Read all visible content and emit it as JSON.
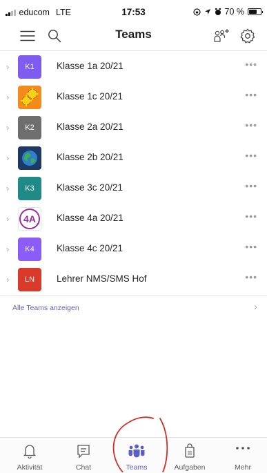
{
  "status_bar": {
    "carrier": "educom",
    "network": "LTE",
    "time": "17:53",
    "battery": "70 %",
    "battery_level": 0.7
  },
  "header": {
    "title": "Teams",
    "icons": [
      "hamburger-menu-icon",
      "search-icon",
      "add-team-icon",
      "gear-icon"
    ]
  },
  "teams": [
    {
      "name": "Klasse 1a 20/21",
      "avatar_text": "K1",
      "avatar_color": "#7e5cf0",
      "avatar_icon": ""
    },
    {
      "name": "Klasse 1c 20/21",
      "avatar_text": "",
      "avatar_color": "#f28a1c",
      "avatar_icon": "gears-icon"
    },
    {
      "name": "Klasse 2a 20/21",
      "avatar_text": "K2",
      "avatar_color": "#6e6e6e",
      "avatar_icon": ""
    },
    {
      "name": "Klasse 2b 20/21",
      "avatar_text": "",
      "avatar_color": "#1c3a63",
      "avatar_icon": "globe-icon"
    },
    {
      "name": "Klasse 3c 20/21",
      "avatar_text": "K3",
      "avatar_color": "#1f8a86",
      "avatar_icon": ""
    },
    {
      "name": "Klasse 4a 20/21",
      "avatar_text": "4A",
      "avatar_color": "#ffffff",
      "avatar_icon": "4a-logo-icon"
    },
    {
      "name": "Klasse 4c 20/21",
      "avatar_text": "K4",
      "avatar_color": "#8b5cf6",
      "avatar_icon": ""
    },
    {
      "name": "Lehrer NMS/SMS Hof",
      "avatar_text": "LN",
      "avatar_color": "#d83b2b",
      "avatar_icon": ""
    }
  ],
  "all_teams_link": "Alle Teams anzeigen",
  "tabs": [
    {
      "label": "Aktivität",
      "icon": "bell-icon",
      "active": false
    },
    {
      "label": "Chat",
      "icon": "chat-icon",
      "active": false
    },
    {
      "label": "Teams",
      "icon": "teams-icon",
      "active": true
    },
    {
      "label": "Aufgaben",
      "icon": "assignments-icon",
      "active": false
    },
    {
      "label": "Mehr",
      "icon": "more-icon",
      "active": false
    }
  ],
  "colors": {
    "accent": "#5b5fc7",
    "annotation": "#d0302a"
  }
}
